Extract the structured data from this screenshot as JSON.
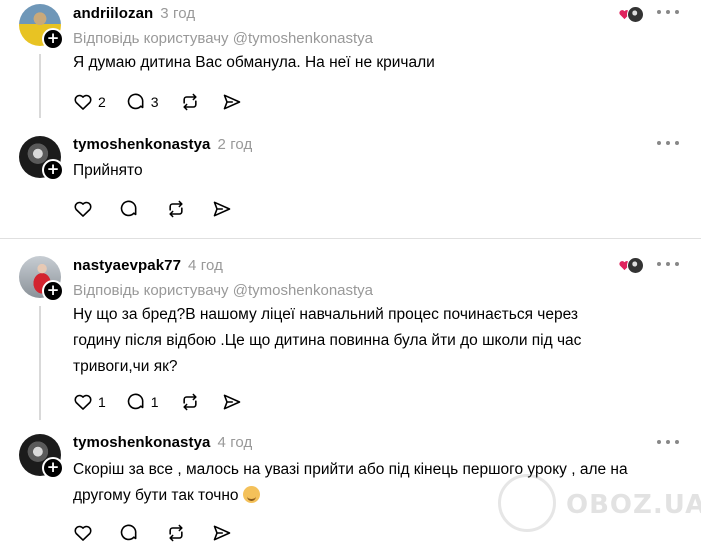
{
  "posts": [
    {
      "username": "andriilozan",
      "time": "3 год",
      "reply_to": "Відповідь користувачу @tymoshenkonastya",
      "text_lines": [
        "Я думаю дитина Вас обманула. На неї не кричали"
      ],
      "likes": "2",
      "comments": "3",
      "avatar": "yellow-jersey-avatar"
    },
    {
      "username": "tymoshenkonastya",
      "time": "2 год",
      "text_lines": [
        "Прийнято"
      ],
      "avatar": "dark-portrait-avatar"
    },
    {
      "username": "nastyaevpak77",
      "time": "4 год",
      "reply_to": "Відповідь користувачу @tymoshenkonastya",
      "text_lines": [
        "Ну що за бред?В нашому ліцеї навчальний процес починається через",
        "годину після відбою .Це що дитина повинна була йти до школи під час",
        "тривоги,чи як?"
      ],
      "likes": "1",
      "comments": "1",
      "avatar": "red-dress-avatar"
    },
    {
      "username": "tymoshenkonastya",
      "time": "4 год",
      "text_lines": [
        "Скоріш за все , малось на увазі прийти або під кінець першого уроку , але на",
        "другому бути так точно"
      ],
      "avatar": "dark-portrait-avatar"
    }
  ],
  "icons": {
    "like": "heart-icon",
    "comment": "comment-bubble-icon",
    "repost": "repost-icon",
    "share": "send-icon",
    "more": "more-dots-icon",
    "follow": "plus-icon"
  },
  "watermark": {
    "text": "OBOZ.UA"
  }
}
